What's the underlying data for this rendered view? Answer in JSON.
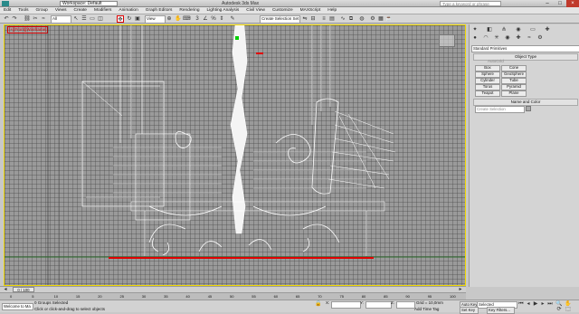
{
  "titlebar": {
    "workspace": "Workspace: Default",
    "title": "Autodesk 3ds Max",
    "search_placeholder": "Type a keyword or phrase"
  },
  "menu": [
    "Edit",
    "Tools",
    "Group",
    "Views",
    "Create",
    "Modifiers",
    "Animation",
    "Graph Editors",
    "Rendering",
    "Lighting Analysis",
    "Civil View",
    "Customize",
    "MAXScript",
    "Help"
  ],
  "toolbar": {
    "filter_value": "All",
    "view_value": "View",
    "selection_set": "Create Selection Set"
  },
  "viewport": {
    "label": "[+][Front][Wireframe]"
  },
  "command_panel": {
    "category": "Standard Primitives",
    "object_type_header": "Object Type",
    "autogrid": "AutoGrid",
    "objects": [
      "Box",
      "Cone",
      "Sphere",
      "GeoSphere",
      "Cylinder",
      "Tube",
      "Torus",
      "Pyramid",
      "Teapot",
      "Plane"
    ],
    "name_color_header": "Name and Color",
    "name_placeholder": "Create Selection"
  },
  "timeline": {
    "frame": "0 / 100",
    "ticks": [
      "0",
      "5",
      "10",
      "15",
      "20",
      "25",
      "30",
      "35",
      "40",
      "45",
      "50",
      "55",
      "60",
      "65",
      "70",
      "75",
      "80",
      "85",
      "90",
      "95",
      "100"
    ]
  },
  "status": {
    "welcome": "Welcome to Ma",
    "selected": "0 Groups Selected",
    "prompt": "Click or click-and-drag to select objects",
    "x_label": "X:",
    "y_label": "Y:",
    "z_label": "Z:",
    "grid": "Grid = 10,0mm",
    "add_time_tag": "Add Time Tag",
    "auto_key": "Auto Key",
    "selected_dropdown": "Selected",
    "set_key": "Set Key",
    "key_filters": "Key Filters..."
  },
  "colors": {
    "viewport_border": "#f0d800",
    "viewport_label": "#d80000",
    "ground_line": "#e00000",
    "wireframe": "#ffffff"
  }
}
